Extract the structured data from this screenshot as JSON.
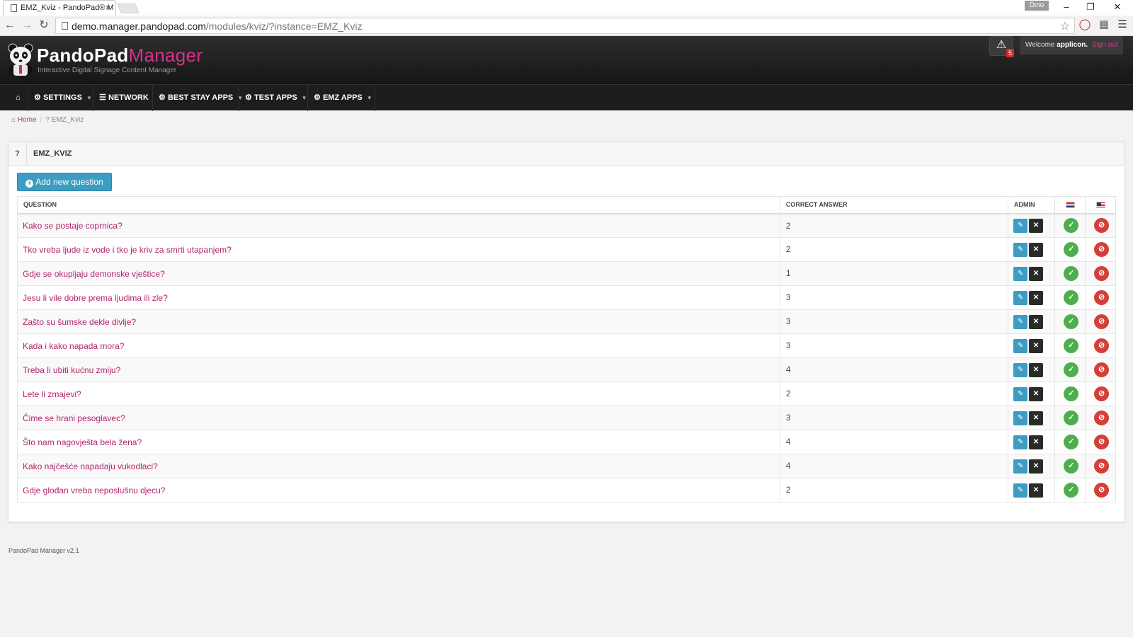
{
  "browser": {
    "tab_title": "EMZ_Kviz - PandoPad® M",
    "tab_close": "×",
    "user_badge": "Dino",
    "url_host": "demo.manager.pandopad.com",
    "url_path": "/modules/kviz/?instance=EMZ_Kviz"
  },
  "header": {
    "brand_main": "PandoPad",
    "brand_accent": "Manager",
    "tagline": "Interactive Digital Signage Content Manager",
    "alert_count": "5",
    "welcome_prefix": "Welcome",
    "username": "applicon.",
    "signout": "Sign out"
  },
  "nav": {
    "settings": "Settings",
    "network": "Network",
    "best_stay_apps": "Best Stay Apps",
    "test_apps": "Test Apps",
    "emz_apps": "EMZ Apps"
  },
  "breadcrumb": {
    "home": "Home",
    "current": "EMZ_Kviz"
  },
  "panel": {
    "icon": "?",
    "title": "EMZ_KVIZ",
    "add_button": "Add new question"
  },
  "table": {
    "headers": {
      "question": "Question",
      "correct_answer": "Correct answer",
      "admin": "Admin"
    },
    "rows": [
      {
        "question": "Kako se postaje coprnica?",
        "answer": "2"
      },
      {
        "question": "Tko vreba ljude iz vode i tko je kriv za smrti utapanjem?",
        "answer": "2"
      },
      {
        "question": "Gdje se okupljaju demonske vještice?",
        "answer": "1"
      },
      {
        "question": "Jesu li vile dobre prema ljudima ili zle?",
        "answer": "3"
      },
      {
        "question": "Zašto su šumske dekle divlje?",
        "answer": "3"
      },
      {
        "question": "Kada i kako napada mora?",
        "answer": "3"
      },
      {
        "question": "Treba li ubiti kućnu zmiju?",
        "answer": "4"
      },
      {
        "question": "Lete li zmajevi?",
        "answer": "2"
      },
      {
        "question": "Čime se hrani pesoglavec?",
        "answer": "3"
      },
      {
        "question": "Što nam nagovješta bela žena?",
        "answer": "4"
      },
      {
        "question": "Kako najčešće napadaju vukodlaci?",
        "answer": "4"
      },
      {
        "question": "Gdje glođan vreba neposlušnu djecu?",
        "answer": "2"
      }
    ]
  },
  "footer": {
    "version": "PandoPad Manager v2.1"
  },
  "colors": {
    "accent_pink": "#d6338a",
    "link": "#b3246a",
    "info_blue": "#3c9dc3",
    "success": "#4cae4c",
    "danger": "#d43f3a"
  }
}
